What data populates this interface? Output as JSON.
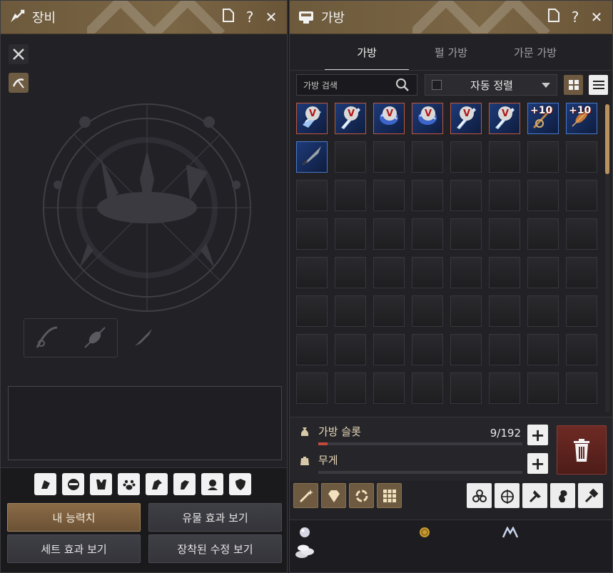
{
  "equipment": {
    "title": "장비",
    "buttons": {
      "my_stats": "내 능력치",
      "artifact_effects": "유물 효과 보기",
      "set_effects": "세트 효과 보기",
      "equipped_edits": "장착된 수정 보기"
    },
    "pet_icons": [
      "pet-icon-1",
      "mask-icon",
      "armor-icon",
      "paw-icon",
      "horse-icon",
      "dog-icon",
      "face-icon",
      "shield-icon"
    ]
  },
  "bag": {
    "title": "가방",
    "tabs": [
      {
        "label": "가방",
        "active": true
      },
      {
        "label": "펄 가방",
        "active": false
      },
      {
        "label": "가문 가방",
        "active": false
      }
    ],
    "search": {
      "placeholder": "가방 검색"
    },
    "sort_label": "자동 정렬",
    "slots_label": "가방 슬롯",
    "slots_count": "9/192",
    "slots_fill": 0.047,
    "weight_label": "무게",
    "weight_fill": 0,
    "items": [
      {
        "badge": "V",
        "type": "gloves",
        "border": "red"
      },
      {
        "badge": "V",
        "type": "blade",
        "border": "red"
      },
      {
        "badge": "V",
        "type": "armor",
        "border": "red"
      },
      {
        "badge": "V",
        "type": "armor",
        "border": "red"
      },
      {
        "badge": "V",
        "type": "blade",
        "border": "red"
      },
      {
        "badge": "V",
        "type": "blade",
        "border": "red"
      },
      {
        "badge": "+10",
        "type": "rod",
        "border": "blue"
      },
      {
        "badge": "+10",
        "type": "float",
        "border": "blue"
      },
      {
        "badge": "",
        "type": "knife",
        "border": "blue"
      }
    ]
  }
}
